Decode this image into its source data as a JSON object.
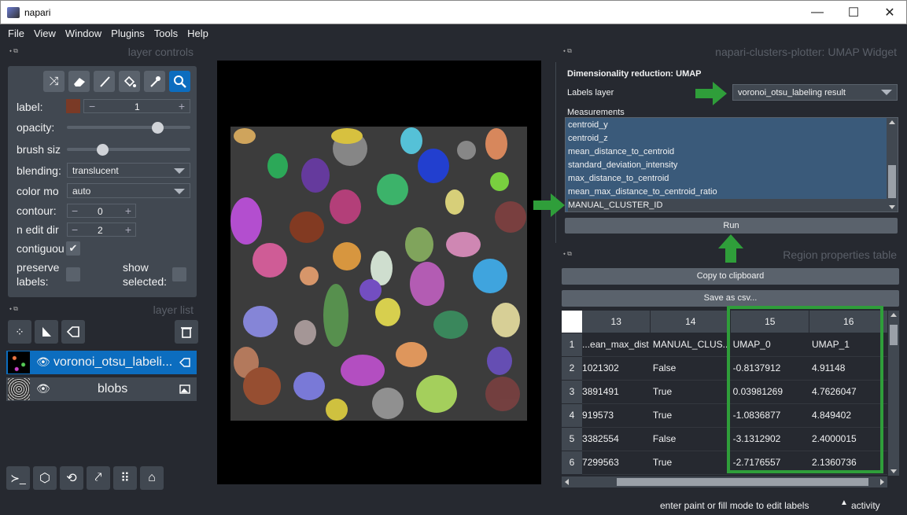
{
  "window": {
    "title": "napari",
    "min": "—",
    "max": "☐",
    "close": "✕"
  },
  "menu": [
    "File",
    "View",
    "Window",
    "Plugins",
    "Tools",
    "Help"
  ],
  "layer_controls": {
    "title": "layer controls",
    "label_label": "label:",
    "label_value": "1",
    "opacity_label": "opacity:",
    "brush_label": "brush siz",
    "blending_label": "blending:",
    "blending_value": "translucent",
    "color_mode_label": "color mo",
    "color_mode_value": "auto",
    "contour_label": "contour:",
    "contour_value": "0",
    "ndim_label": "n edit dir",
    "ndim_value": "2",
    "contiguous_label": "contiguou",
    "preserve_label_1": "preserve",
    "preserve_label_2": "labels:",
    "show_selected_1": "show",
    "show_selected_2": "selected:",
    "opacity_value": 0.72,
    "brush_value": 0.25
  },
  "layer_list": {
    "title": "layer list",
    "layers": [
      {
        "name": "voronoi_otsu_labeli..."
      },
      {
        "name": "blobs"
      }
    ]
  },
  "umap": {
    "title": "napari-clusters-plotter: UMAP Widget",
    "heading": "Dimensionality reduction: UMAP",
    "labels_layer_label": "Labels layer",
    "labels_layer_value": "voronoi_otsu_labeling result",
    "measurements_label": "Measurements",
    "measurements": [
      "centroid_y",
      "centroid_z",
      "mean_distance_to_centroid",
      "standard_deviation_intensity",
      "max_distance_to_centroid",
      "mean_max_distance_to_centroid_ratio",
      "MANUAL_CLUSTER_ID"
    ],
    "run_label": "Run"
  },
  "table": {
    "title": "Region properties table",
    "copy_label": "Copy to clipboard",
    "save_label": "Save as csv...",
    "columns": [
      "13",
      "14",
      "15",
      "16"
    ],
    "rows": [
      {
        "n": "1",
        "c": [
          "ean_max_dist...",
          "MANUAL_CLUS...",
          "UMAP_0",
          "UMAP_1"
        ]
      },
      {
        "n": "2",
        "c": [
          "1021302",
          "False",
          "-0.8137912",
          "4.91148"
        ]
      },
      {
        "n": "3",
        "c": [
          "3891491",
          "True",
          "0.03981269",
          "4.7626047"
        ]
      },
      {
        "n": "4",
        "c": [
          "919573",
          "True",
          "-1.0836877",
          "4.849402"
        ]
      },
      {
        "n": "5",
        "c": [
          "3382554",
          "False",
          "-3.1312902",
          "2.4000015"
        ]
      },
      {
        "n": "6",
        "c": [
          "7299563",
          "True",
          "-2.7176557",
          "2.1360736"
        ]
      }
    ]
  },
  "status": {
    "message": "enter paint or fill mode to edit labels",
    "activity": "activity"
  },
  "colors": {
    "bg": "#262930",
    "panel": "#414851",
    "selected": "#0c6dbf",
    "highlight": "#2f9e3a"
  }
}
